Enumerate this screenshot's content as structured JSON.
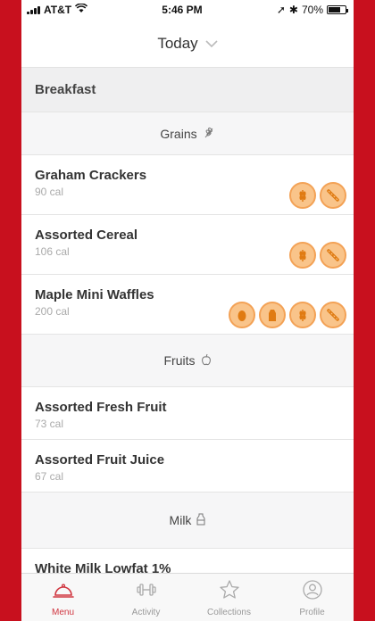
{
  "status_bar": {
    "carrier": "AT&T",
    "time": "5:46 PM",
    "battery": "70%"
  },
  "header": {
    "title": "Today"
  },
  "section": {
    "title": "Breakfast"
  },
  "categories": {
    "grains": "Grains",
    "fruits": "Fruits",
    "milk": "Milk"
  },
  "items": [
    {
      "name": "Graham Crackers",
      "cal": "90 cal",
      "badges": [
        "wheat-icon",
        "gluten-icon"
      ]
    },
    {
      "name": "Assorted Cereal",
      "cal": "106 cal",
      "badges": [
        "wheat-icon",
        "gluten-icon"
      ]
    },
    {
      "name": "Maple Mini Waffles",
      "cal": "200 cal",
      "badges": [
        "egg-icon",
        "milk-carton-icon",
        "wheat-icon",
        "gluten-icon"
      ]
    },
    {
      "name": "Assorted Fresh Fruit",
      "cal": "73 cal"
    },
    {
      "name": "Assorted Fruit Juice",
      "cal": "67 cal"
    },
    {
      "name": "White Milk Lowfat 1%",
      "cal": ""
    }
  ],
  "tabs": [
    {
      "label": "Menu",
      "icon": "cloche-icon",
      "active": true
    },
    {
      "label": "Activity",
      "icon": "dumbbell-icon"
    },
    {
      "label": "Collections",
      "icon": "star-icon"
    },
    {
      "label": "Profile",
      "icon": "profile-icon"
    }
  ],
  "colors": {
    "brand": "#c8101e",
    "accent_orange": "#f3a256",
    "tab_active": "#d0353f"
  }
}
